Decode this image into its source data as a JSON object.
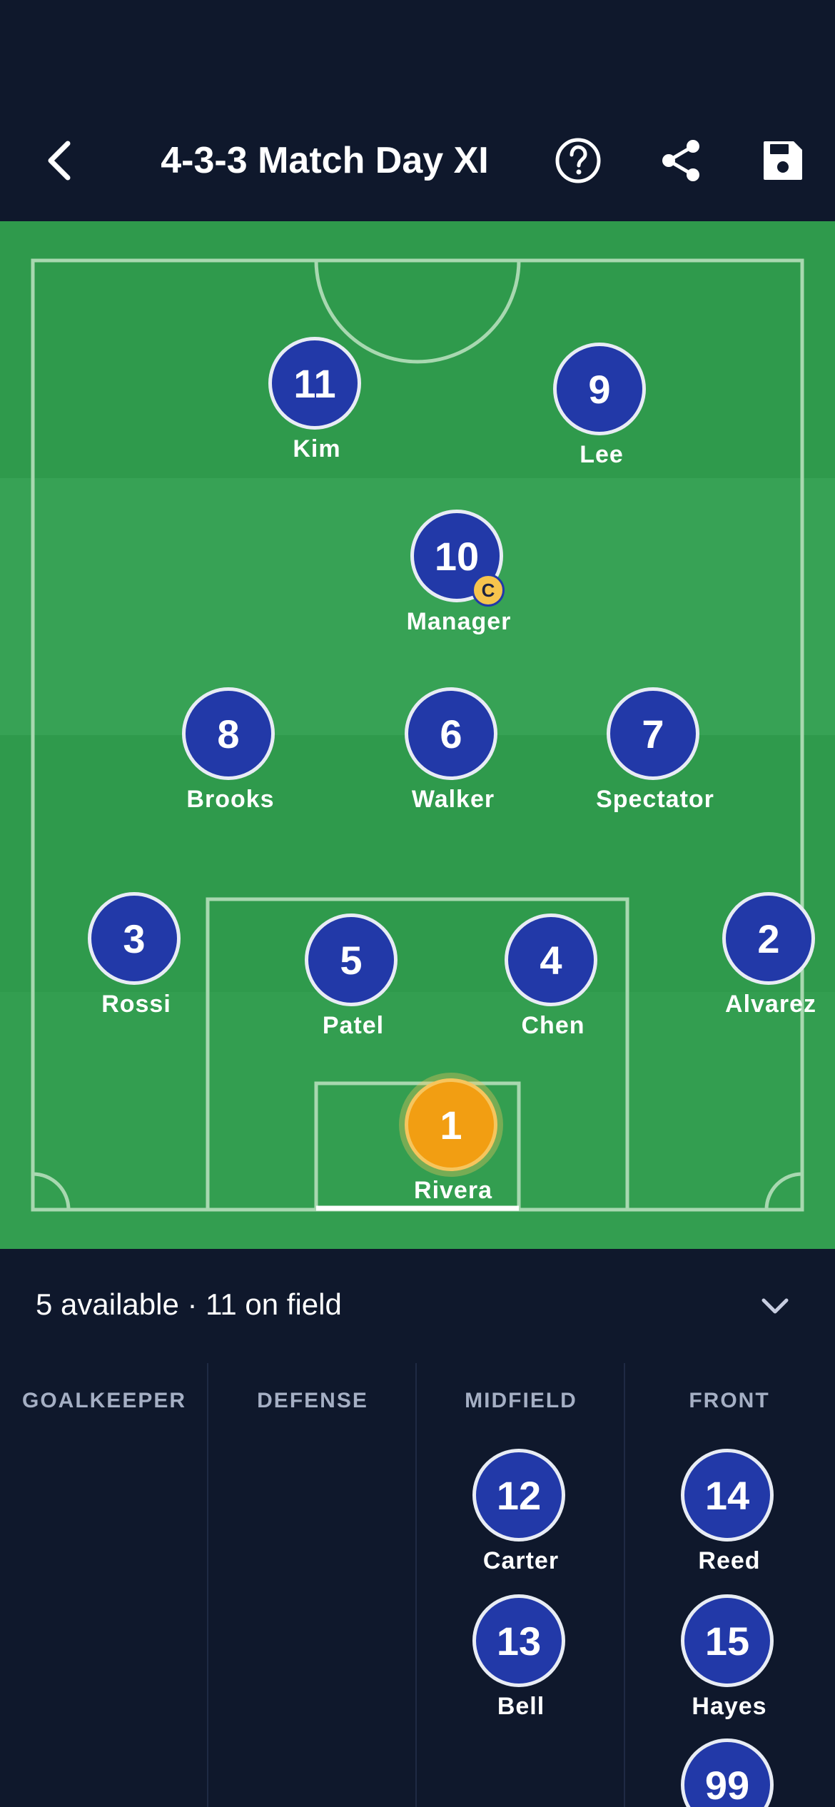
{
  "header": {
    "title": "4-3-3 Match Day XI",
    "back_icon": "chevron-left-icon",
    "help_icon": "question-circle-icon",
    "share_icon": "share-icon",
    "save_icon": "floppy-disk-icon"
  },
  "colors": {
    "background": "#0f182c",
    "pitch": "#2f9a4c",
    "player_token": "#2239a8",
    "goalkeeper_token": "#f29e12",
    "captain_badge": "#f7c44d"
  },
  "formation": "4-3-3",
  "players_on_field": [
    {
      "number": "11",
      "name": "Kim",
      "role": "forward"
    },
    {
      "number": "9",
      "name": "Lee",
      "role": "forward"
    },
    {
      "number": "10",
      "name": "Manager",
      "role": "attacking-mid",
      "captain": "C"
    },
    {
      "number": "8",
      "name": "Brooks",
      "role": "midfield"
    },
    {
      "number": "6",
      "name": "Walker",
      "role": "midfield"
    },
    {
      "number": "7",
      "name": "Spectator",
      "role": "midfield"
    },
    {
      "number": "3",
      "name": "Rossi",
      "role": "defense"
    },
    {
      "number": "5",
      "name": "Patel",
      "role": "defense"
    },
    {
      "number": "4",
      "name": "Chen",
      "role": "defense"
    },
    {
      "number": "2",
      "name": "Alvarez",
      "role": "defense"
    },
    {
      "number": "1",
      "name": "Rivera",
      "role": "goalkeeper"
    }
  ],
  "bench": {
    "summary": "5 available · 11 on field",
    "chevron_icon": "chevron-down-icon",
    "columns": [
      {
        "label": "GOALKEEPER",
        "players": []
      },
      {
        "label": "DEFENSE",
        "players": []
      },
      {
        "label": "MIDFIELD",
        "players": [
          {
            "number": "12",
            "name": "Carter"
          },
          {
            "number": "13",
            "name": "Bell"
          }
        ]
      },
      {
        "label": "FRONT",
        "players": [
          {
            "number": "14",
            "name": "Reed"
          },
          {
            "number": "15",
            "name": "Hayes"
          },
          {
            "number": "99",
            "name": ""
          }
        ]
      }
    ]
  }
}
